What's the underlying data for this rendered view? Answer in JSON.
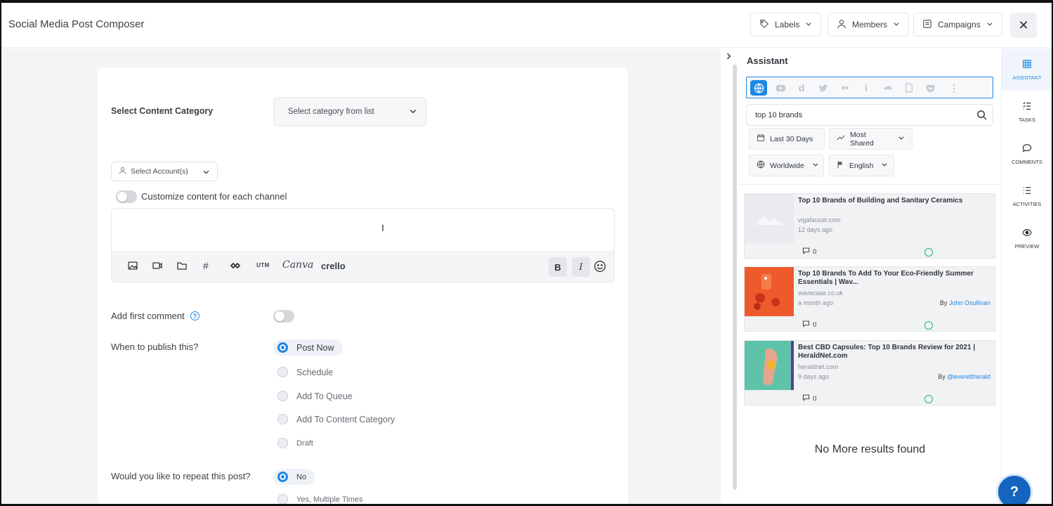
{
  "header": {
    "title": "Social Media Post Composer",
    "labels_btn": "Labels",
    "members_btn": "Members",
    "campaigns_btn": "Campaigns",
    "close_icon": "close-icon"
  },
  "composer": {
    "content_category_label": "Select Content Category",
    "category_select_placeholder": "Select category from list",
    "account_select": "Select Account(s)",
    "customize_label": "Customize content for each channel",
    "toolbar": {
      "utm": "UTM",
      "canva": "Canva",
      "crello": "crello",
      "bold": "B",
      "italic": "I"
    },
    "first_comment_label": "Add first comment",
    "publish_label": "When to publish this?",
    "publish_options": [
      "Post Now",
      "Schedule",
      "Add To Queue",
      "Add To Content Category",
      "Draft"
    ],
    "publish_selected": "Post Now",
    "repeat_label": "Would you like to repeat this post?",
    "repeat_options": [
      "No",
      "Yes, Multiple Times"
    ],
    "repeat_selected": "No"
  },
  "assistant": {
    "title": "Assistant",
    "networks": [
      "web-icon",
      "youtube-icon",
      "dailymotion-icon",
      "twitter-icon",
      "flickr-icon",
      "imgur-icon",
      "giphy-icon",
      "article-icon",
      "pocket-icon",
      "more-icon"
    ],
    "search_value": "top 10 brands",
    "filters": {
      "date": "Last 30 Days",
      "sort": "Most Shared",
      "region": "Worldwide",
      "language": "English"
    },
    "results": [
      {
        "title": "Top 10 Brands of Building and Sanitary Ceramics",
        "domain": "vigafaucet.com",
        "time": "12 days ago",
        "by": "",
        "author": "",
        "comments": "0"
      },
      {
        "title": "Top 10 Brands To Add To Your Eco-Friendly Summer Essentials | Wav...",
        "domain": "wavecase.co.uk",
        "time": "a month ago",
        "by": "By",
        "author": "John Osullivan",
        "comments": "0"
      },
      {
        "title": "Best CBD Capsules: Top 10 Brands Review for 2021 | HeraldNet.com",
        "domain": "heraldnet.com",
        "time": "9 days ago",
        "by": "By",
        "author": "@everettherald",
        "comments": "0"
      }
    ],
    "no_more": "No More results found"
  },
  "rail": {
    "items": [
      "ASSISTANT",
      "TASKS",
      "COMMENTS",
      "ACTIVITIES",
      "PREVIEW"
    ],
    "active": "ASSISTANT"
  },
  "help_fab": "?"
}
